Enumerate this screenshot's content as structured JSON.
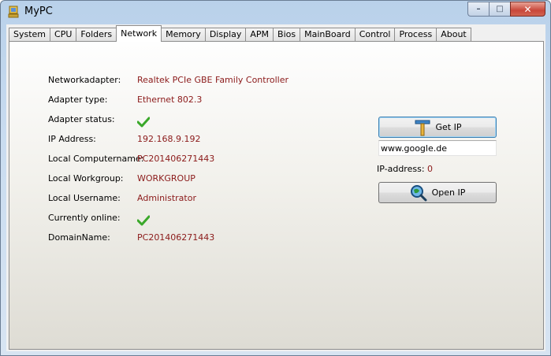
{
  "window": {
    "title": "MyPC",
    "minimize": "–",
    "maximize": "□",
    "close": "✕"
  },
  "tabs": [
    "System",
    "CPU",
    "Folders",
    "Network",
    "Memory",
    "Display",
    "APM",
    "Bios",
    "MainBoard",
    "Control",
    "Process",
    "About"
  ],
  "active_tab": "Network",
  "network": {
    "adapter_label": "Networkadapter:",
    "adapter_value": "Realtek PCIe GBE Family Controller",
    "type_label": "Adapter type:",
    "type_value": "Ethernet 802.3",
    "status_label": "Adapter status:",
    "status_icon": "checkmark-icon",
    "ip_label": "IP Address:",
    "ip_value": "192.168.9.192",
    "computer_label": "Local Computername:",
    "computer_value": "PC201406271443",
    "workgroup_label": "Local Workgroup:",
    "workgroup_value": "WORKGROUP",
    "username_label": "Local Username:",
    "username_value": "Administrator",
    "online_label": "Currently online:",
    "online_icon": "checkmark-icon",
    "domain_label": "DomainName:",
    "domain_value": "PC201406271443"
  },
  "lookup": {
    "get_ip_label": "Get IP",
    "url_value": "www.google.de",
    "ip_address_label": "IP-address:",
    "ip_address_value": "0",
    "open_ip_label": "Open IP"
  },
  "colors": {
    "value_text": "#8b1a1a",
    "check_green": "#3aa82a"
  }
}
